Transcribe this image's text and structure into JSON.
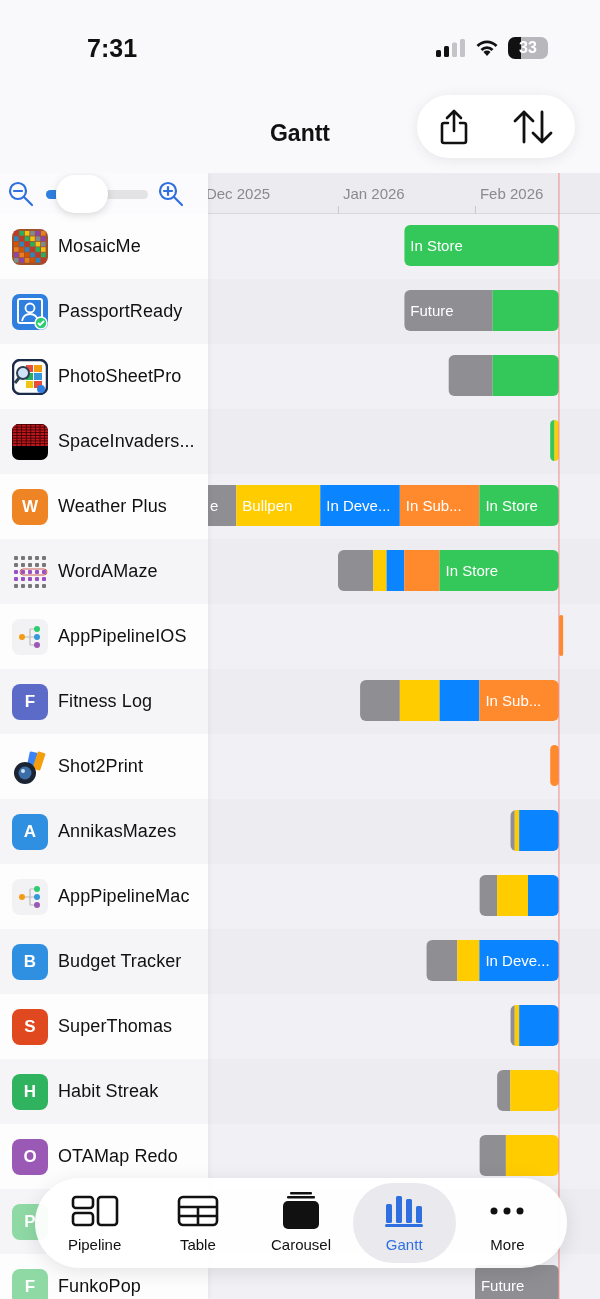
{
  "status_bar": {
    "time": "7:31",
    "battery": "33"
  },
  "header": {
    "title": "Gantt"
  },
  "zoom": {
    "level": 0.1
  },
  "timeline": {
    "months": [
      "Dec 2025",
      "Jan 2026",
      "Feb 2026"
    ]
  },
  "rows": [
    {
      "name": "MosaicMe",
      "icon": {
        "kind": "mosaic"
      },
      "segments": [
        {
          "label": "In Store",
          "color": "#34c759"
        }
      ]
    },
    {
      "name": "PassportReady",
      "icon": {
        "kind": "portrait"
      },
      "segments": [
        {
          "label": "Future",
          "color": "#8e8e93"
        },
        {
          "color": "#34c759"
        }
      ]
    },
    {
      "name": "PhotoSheetPro",
      "icon": {
        "kind": "sheets"
      },
      "segments": [
        {
          "color": "#8e8e93"
        },
        {
          "color": "#34c759"
        }
      ]
    },
    {
      "name": "SpaceInvaders...",
      "icon": {
        "kind": "invaders"
      },
      "segments": [
        {
          "color": "#34c759"
        },
        {
          "color": "#ffcc00"
        }
      ]
    },
    {
      "name": "Weather Plus",
      "icon": {
        "kind": "letter",
        "letter": "W",
        "color": "#ef8424"
      },
      "segments": [
        {
          "label": "e",
          "color": "#8e8e93"
        },
        {
          "label": "Bullpen",
          "color": "#ffcc00"
        },
        {
          "label": "In Deve...",
          "color": "#0a84ff"
        },
        {
          "label": "In Sub...",
          "color": "#ff8a2e"
        },
        {
          "label": "In Store",
          "color": "#34c759"
        }
      ]
    },
    {
      "name": "WordAMaze",
      "icon": {
        "kind": "wordgrid"
      },
      "segments": [
        {
          "color": "#8e8e93"
        },
        {
          "color": "#ffcc00"
        },
        {
          "color": "#0a84ff"
        },
        {
          "color": "#ff8a2e"
        },
        {
          "label": "In Store",
          "color": "#34c759"
        }
      ]
    },
    {
      "name": "AppPipelineIOS",
      "icon": {
        "kind": "tree"
      },
      "segments": [
        {
          "color": "#ff8a2e"
        }
      ]
    },
    {
      "name": "Fitness Log",
      "icon": {
        "kind": "letter",
        "letter": "F",
        "color": "#5d6bc8"
      },
      "segments": [
        {
          "color": "#8e8e93"
        },
        {
          "color": "#ffcc00"
        },
        {
          "color": "#0a84ff"
        },
        {
          "label": "In Sub...",
          "color": "#ff8a2e"
        }
      ]
    },
    {
      "name": "Shot2Print",
      "icon": {
        "kind": "camera"
      },
      "segments": [
        {
          "color": "#ff8a2e"
        }
      ]
    },
    {
      "name": "AnnikasMazes",
      "icon": {
        "kind": "letter",
        "letter": "A",
        "color": "#2f8fe0"
      },
      "segments": [
        {
          "color": "#8e8e93"
        },
        {
          "color": "#ffcc00"
        },
        {
          "color": "#0a84ff"
        }
      ]
    },
    {
      "name": "AppPipelineMac",
      "icon": {
        "kind": "tree"
      },
      "segments": [
        {
          "color": "#8e8e93"
        },
        {
          "color": "#ffcc00"
        },
        {
          "color": "#0a84ff"
        }
      ]
    },
    {
      "name": "Budget Tracker",
      "icon": {
        "kind": "letter",
        "letter": "B",
        "color": "#2f8fe0"
      },
      "segments": [
        {
          "color": "#8e8e93"
        },
        {
          "color": "#ffcc00"
        },
        {
          "label": "In Deve...",
          "color": "#0a84ff"
        }
      ]
    },
    {
      "name": "SuperThomas",
      "icon": {
        "kind": "letter",
        "letter": "S",
        "color": "#e0481f"
      },
      "segments": [
        {
          "color": "#8e8e93"
        },
        {
          "color": "#ffcc00"
        },
        {
          "color": "#0a84ff"
        }
      ]
    },
    {
      "name": "Habit Streak",
      "icon": {
        "kind": "letter",
        "letter": "H",
        "color": "#2fb35f"
      },
      "segments": [
        {
          "color": "#8e8e93"
        },
        {
          "color": "#ffcc00"
        }
      ]
    },
    {
      "name": "OTAMap Redo",
      "icon": {
        "kind": "letter",
        "letter": "O",
        "color": "#9b59b6"
      },
      "segments": [
        {
          "color": "#8e8e93"
        },
        {
          "color": "#ffcc00"
        }
      ]
    },
    {
      "icon": {
        "kind": "letter",
        "letter": "P",
        "color": "#8fd9a5"
      }
    },
    {
      "name": "FunkoPop",
      "icon": {
        "kind": "letter",
        "letter": "F",
        "color": "#8fd9a5"
      },
      "segments": [
        {
          "label": "Future",
          "color": "#8e8e93"
        }
      ]
    }
  ],
  "tab_bar": [
    {
      "kind": "pipeline",
      "label": "Pipeline",
      "selected": false
    },
    {
      "kind": "table",
      "label": "Table",
      "selected": false
    },
    {
      "kind": "carousel",
      "label": "Carousel",
      "selected": false
    },
    {
      "kind": "gantt",
      "label": "Gantt",
      "selected": true
    },
    {
      "kind": "more",
      "label": "More",
      "selected": false
    }
  ]
}
